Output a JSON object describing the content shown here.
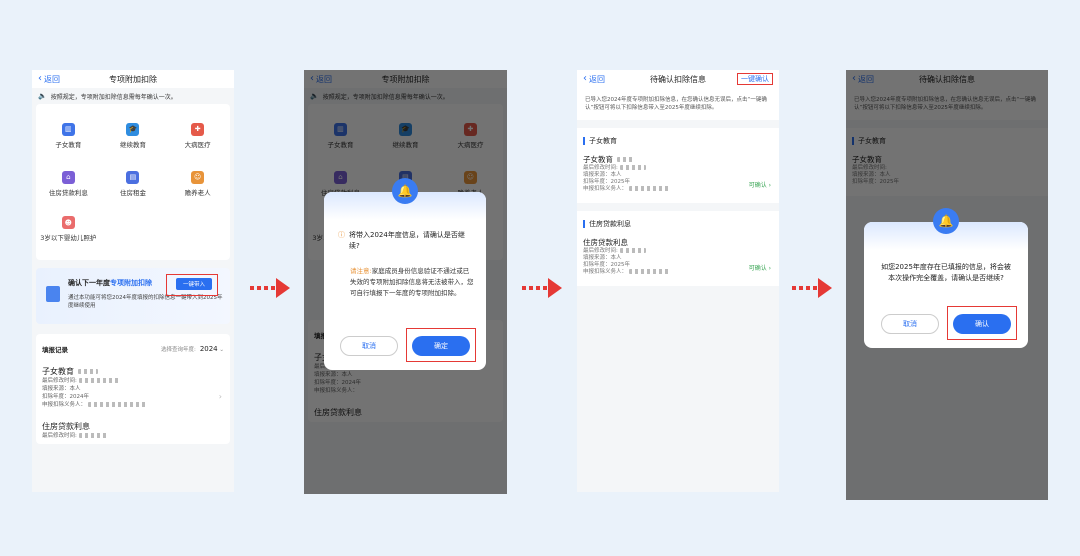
{
  "screen1": {
    "nav": {
      "back": "返回",
      "title": "专项附加扣除"
    },
    "notice": "按照规定，专项附加扣除信息需每年确认一次。",
    "categories": [
      {
        "label": "子女教育",
        "color": "#3f74e8"
      },
      {
        "label": "继续教育",
        "color": "#2f8de0"
      },
      {
        "label": "大病医疗",
        "color": "#e55a4a"
      },
      {
        "label": "住房贷款利息",
        "color": "#7b5fd6"
      },
      {
        "label": "住房租金",
        "color": "#4b6fe0"
      },
      {
        "label": "赡养老人",
        "color": "#e8943a"
      },
      {
        "label": "3岁以下婴幼儿照护",
        "color": "#ea6c6c"
      }
    ],
    "promo": {
      "title_prefix": "确认下一年度",
      "title_highlight": "专项附加扣除",
      "desc": "通过本功能可将您2024年度填报的扣除信息一键带入到2025年度继续使用",
      "button": "一键带入"
    },
    "records_header": {
      "title": "填报记录",
      "year_label": "选择查询年度:",
      "year": "2024"
    },
    "records": [
      {
        "name": "子女教育",
        "lines": [
          "最后修改时间:",
          "填报来源：本人",
          "扣除年度：2024年",
          "申报扣除义务人："
        ]
      },
      {
        "name": "住房贷款利息",
        "lines": [
          "最后修改时间:"
        ]
      }
    ]
  },
  "screen2": {
    "dialog": {
      "question": "将带入2024年度信息，请确认是否继续?",
      "note_label": "请注意:",
      "note": "家庭成员身份信息验证不通过或已失效的专项附加扣除信息将无法被带入，您可自行填报下一年度的专项附加扣除。",
      "cancel": "取消",
      "ok": "确定"
    }
  },
  "screen3": {
    "nav": {
      "back": "返回",
      "title": "待确认扣除信息",
      "action": "一键确认"
    },
    "intro": "已导入您2024年度专项附加扣除信息，在您确认信息无误后，点击“一键确认”按钮可将以下扣除信息带入至2025年度继续扣除。",
    "sections": [
      {
        "title": "子女教育",
        "name": "子女教育",
        "lines": [
          "最后修改时间:",
          "填报来源：本人",
          "扣除年度：2025年",
          "申报扣除义务人："
        ],
        "status": "可确认 ›"
      },
      {
        "title": "住房贷款利息",
        "name": "住房贷款利息",
        "lines": [
          "最后修改时间:",
          "填报来源：本人",
          "扣除年度：2025年",
          "申报扣除义务人："
        ],
        "status": "可确认 ›"
      }
    ]
  },
  "screen4": {
    "dialog": {
      "message": "如您2025年度存在已填报的信息，将会被本次操作完全覆盖，请确认是否继续?",
      "cancel": "取消",
      "ok": "确认"
    }
  }
}
